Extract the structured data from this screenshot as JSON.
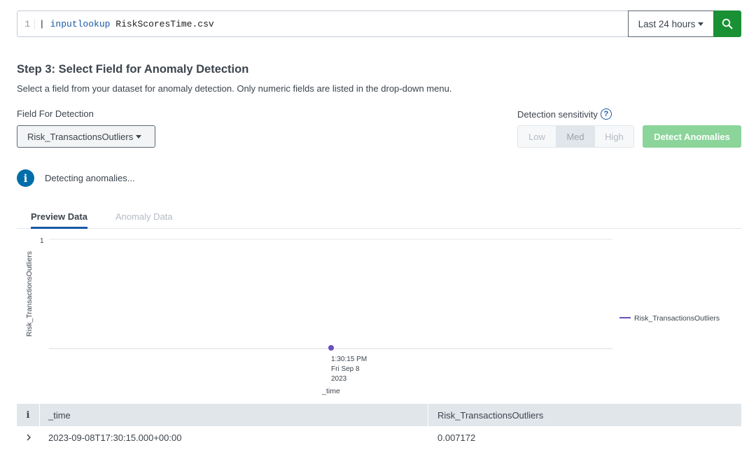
{
  "search": {
    "line_number": "1",
    "pipe": "|",
    "command": "inputlookup",
    "argument": "RiskScoresTime.csv",
    "time_range": "Last 24 hours",
    "search_icon": "search-icon"
  },
  "step": {
    "title": "Step 3: Select Field for Anomaly Detection",
    "description": "Select a field from your dataset for anomaly detection. Only numeric fields are listed in the drop-down menu."
  },
  "field": {
    "label": "Field For Detection",
    "selected": "Risk_TransactionsOutliers"
  },
  "sensitivity": {
    "label": "Detection sensitivity",
    "help": "?",
    "options": [
      "Low",
      "Med",
      "High"
    ],
    "selected": "Med"
  },
  "detect_button": "Detect Anomalies",
  "status": {
    "icon": "i",
    "text": "Detecting anomalies..."
  },
  "tabs": [
    "Preview Data",
    "Anomaly Data"
  ],
  "active_tab": "Preview Data",
  "chart_data": {
    "type": "line",
    "ylabel": "Risk_TransactionsOutliers",
    "xlabel": "_time",
    "y_ticks": [
      "1"
    ],
    "x_tick_lines": [
      "1:30:15 PM",
      "Fri Sep 8",
      "2023"
    ],
    "legend": [
      "Risk_TransactionsOutliers"
    ],
    "legend_position": "right",
    "series": [
      {
        "name": "Risk_TransactionsOutliers",
        "points": [
          {
            "x": "2023-09-08T17:30:15.000+00:00",
            "y": 0.007172
          }
        ]
      }
    ],
    "color": "#6b4fbb"
  },
  "table": {
    "headers": [
      "i",
      "_time",
      "Risk_TransactionsOutliers"
    ],
    "rows": [
      {
        "expand": "›",
        "time": "2023-09-08T17:30:15.000+00:00",
        "value": "0.007172"
      }
    ]
  }
}
